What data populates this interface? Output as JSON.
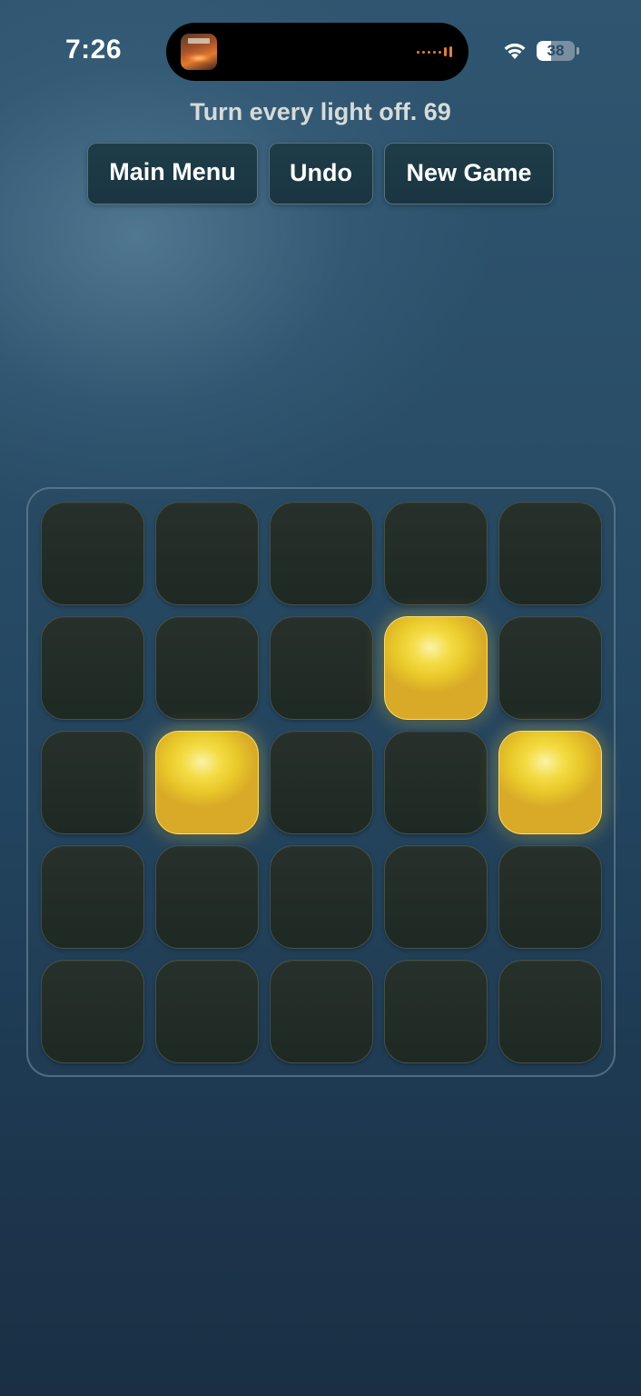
{
  "status_bar": {
    "time": "7:26",
    "battery_level": "38",
    "battery_fraction": 0.38,
    "icons": [
      "app-icon",
      "audio-waveform-icon",
      "wifi-icon",
      "battery-icon"
    ]
  },
  "header": {
    "instruction": "Turn every light off.",
    "moves": "69"
  },
  "buttons": {
    "main_menu": "Main Menu",
    "undo": "Undo",
    "new_game": "New Game"
  },
  "board": {
    "rows": 5,
    "cols": 5,
    "lights": [
      [
        0,
        0,
        0,
        0,
        0
      ],
      [
        0,
        0,
        0,
        1,
        0
      ],
      [
        0,
        1,
        0,
        0,
        1
      ],
      [
        0,
        0,
        0,
        0,
        0
      ],
      [
        0,
        0,
        0,
        0,
        0
      ]
    ]
  },
  "colors": {
    "light_on": "#f1d43a",
    "light_off": "#232c27",
    "button_bg": "#1c3945",
    "text_header": "#d7dbd8"
  }
}
